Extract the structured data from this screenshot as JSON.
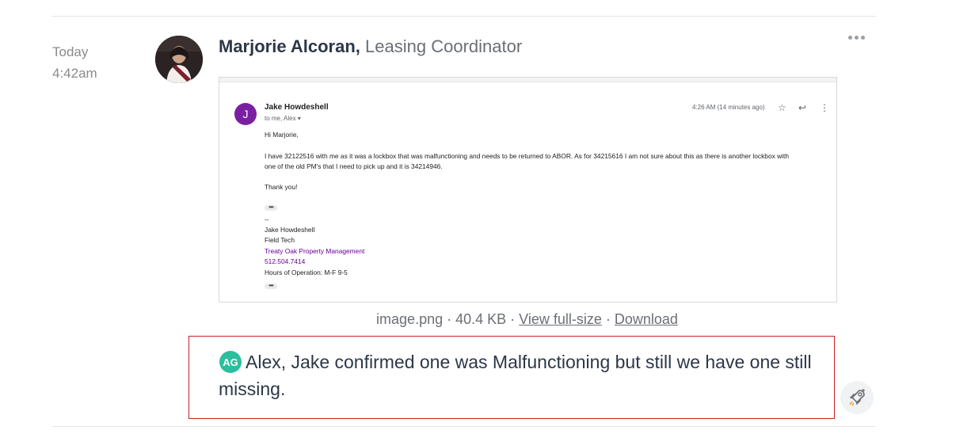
{
  "post": {
    "day": "Today",
    "time": "4:42am",
    "author_name": "Marjorie Alcoran,",
    "author_role": "Leasing Coordinator"
  },
  "email": {
    "avatar_letter": "J",
    "sender": "Jake Howdeshell",
    "recipients": "to me, Alex ▾",
    "time": "4:26 AM (14 minutes ago)",
    "greeting": "Hi Marjorie,",
    "body_line1": "I have 32122516 with me as it was a lockbox that was malfunctioning and needs to be returned to ABOR. As for 34215616 I am not sure about this as there is another lockbox with",
    "body_line2": "one of the old PM's that I need to pick up and it is 34214946.",
    "thanks": "Thank you!",
    "sig_dash": "--",
    "sig_name": "Jake Howdeshell",
    "sig_title": "Field Tech",
    "sig_company": "Treaty Oak Property Management",
    "sig_phone": "512.504.7414",
    "sig_hours": "Hours of Operation: M-F 9-5",
    "ellipsis": "•••"
  },
  "attachment": {
    "filename": "image.png",
    "sep1": " · ",
    "size": "40.4 KB",
    "sep2": " · ",
    "view_label": "View full-size",
    "sep3": " · ",
    "download_label": "Download"
  },
  "reply": {
    "initials": "AG",
    "text": "Alex, Jake confirmed one was Malfunctioning but still we have one still missing."
  },
  "icons": {
    "more": "more-horizontal-icon",
    "rocket": "rocket-icon",
    "star": "star-icon",
    "reply": "reply-arrow-icon",
    "kebab": "more-vertical-icon"
  },
  "colors": {
    "highlight_border": "#cc1e1e",
    "initials_badge": "#2bbf9e",
    "email_avatar": "#7b1fa2"
  }
}
